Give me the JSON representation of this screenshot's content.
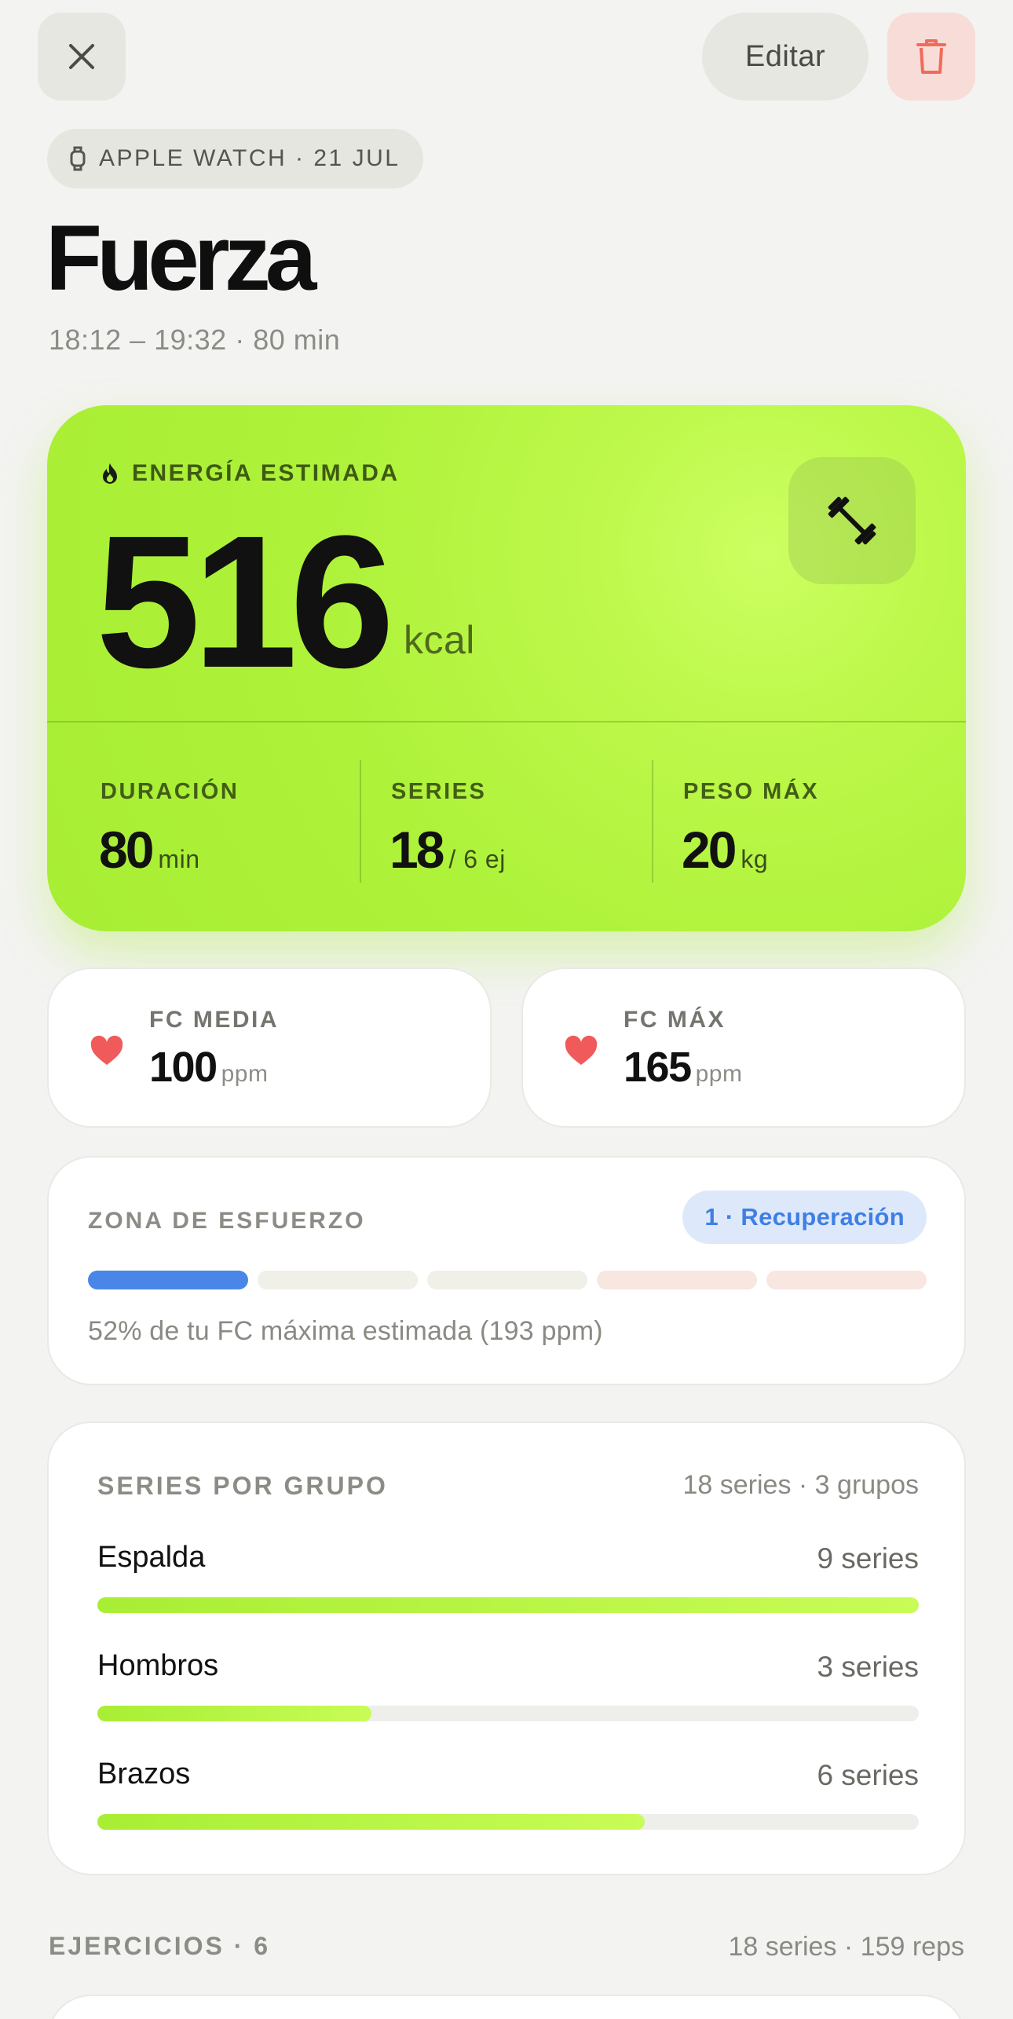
{
  "header": {
    "edit_label": "Editar",
    "close_icon": "close-icon",
    "delete_icon": "trash-icon",
    "delete_color": "#f06b5a"
  },
  "source": {
    "label": "APPLE WATCH · 21 JUL",
    "icon": "watch-icon"
  },
  "workout": {
    "title": "Fuerza",
    "time_range": "18:12 – 19:32 · 80 min"
  },
  "energy": {
    "label": "ENERGÍA ESTIMADA",
    "icon": "flame-icon",
    "value": "516",
    "unit": "kcal",
    "equipment_icon": "dumbbell-icon",
    "accent": "#aef23a"
  },
  "stats": [
    {
      "label": "DURACIÓN",
      "value": "80",
      "unit": "min"
    },
    {
      "label": "SERIES",
      "value": "18",
      "unit": "/ 6 ej"
    },
    {
      "label": "PESO MÁX",
      "value": "20",
      "unit": "kg"
    }
  ],
  "heart_rate": [
    {
      "label": "FC MEDIA",
      "value": "100",
      "unit": "ppm",
      "icon": "heart-icon"
    },
    {
      "label": "FC MÁX",
      "value": "165",
      "unit": "ppm",
      "icon": "heart-icon"
    }
  ],
  "zone": {
    "label": "ZONA DE ESFUERZO",
    "badge": "1 · Recuperación",
    "active_segment": 1,
    "segment_colors": [
      "#4a86e8",
      "#f0f0e8",
      "#f0f0e8",
      "#f8e6e1",
      "#f8e6e1"
    ],
    "description": "52% de tu FC máxima estimada (193 ppm)"
  },
  "groups": {
    "label": "SERIES POR GRUPO",
    "summary": "18 series · 3 grupos",
    "items": [
      {
        "name": "Espalda",
        "count": "9 series",
        "sets": 9
      },
      {
        "name": "Hombros",
        "count": "3 series",
        "sets": 3
      },
      {
        "name": "Brazos",
        "count": "6 series",
        "sets": 6
      }
    ],
    "max_sets": 9
  },
  "exercises": {
    "label": "EJERCICIOS · 6",
    "summary": "18 series · 159 reps"
  }
}
